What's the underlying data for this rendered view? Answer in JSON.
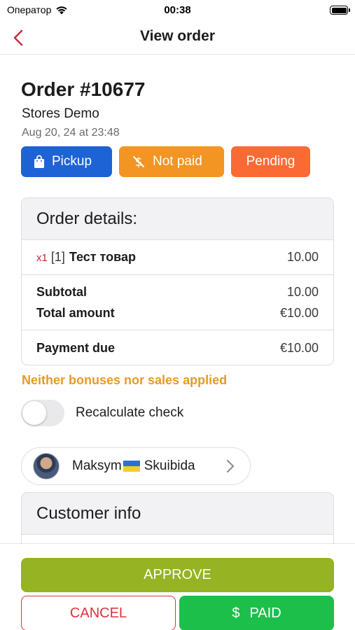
{
  "status_bar": {
    "carrier": "Оператор",
    "time": "00:38"
  },
  "nav": {
    "title": "View order"
  },
  "order": {
    "title": "Order #10677",
    "store": "Stores Demo",
    "date": "Aug 20, 24 at 23:48"
  },
  "badges": {
    "pickup": "Pickup",
    "not_paid": "Not paid",
    "pending": "Pending"
  },
  "details": {
    "header": "Order details:",
    "items": [
      {
        "qty": "x1",
        "position": "[1]",
        "name": "Тест товар",
        "price": "10.00"
      }
    ],
    "subtotal_label": "Subtotal",
    "subtotal_value": "10.00",
    "total_label": "Total amount",
    "total_value": "€10.00",
    "due_label": "Payment due",
    "due_value": "€10.00"
  },
  "notice": "Neither bonuses nor sales applied",
  "recalculate": {
    "label": "Recalculate check",
    "enabled": false
  },
  "customer": {
    "first_name": "Maksym",
    "last_name": "Skuibida"
  },
  "customer_info": {
    "header": "Customer info"
  },
  "actions": {
    "approve": "APPROVE",
    "cancel": "CANCEL",
    "paid": "PAID"
  },
  "colors": {
    "back_accent": "#c8323c",
    "pickup": "#1e63d6",
    "not_paid": "#f29522",
    "pending": "#fb6a34",
    "notice": "#e89a24",
    "approve": "#95b322",
    "cancel": "#e0323c",
    "paid": "#1cbf4a"
  }
}
